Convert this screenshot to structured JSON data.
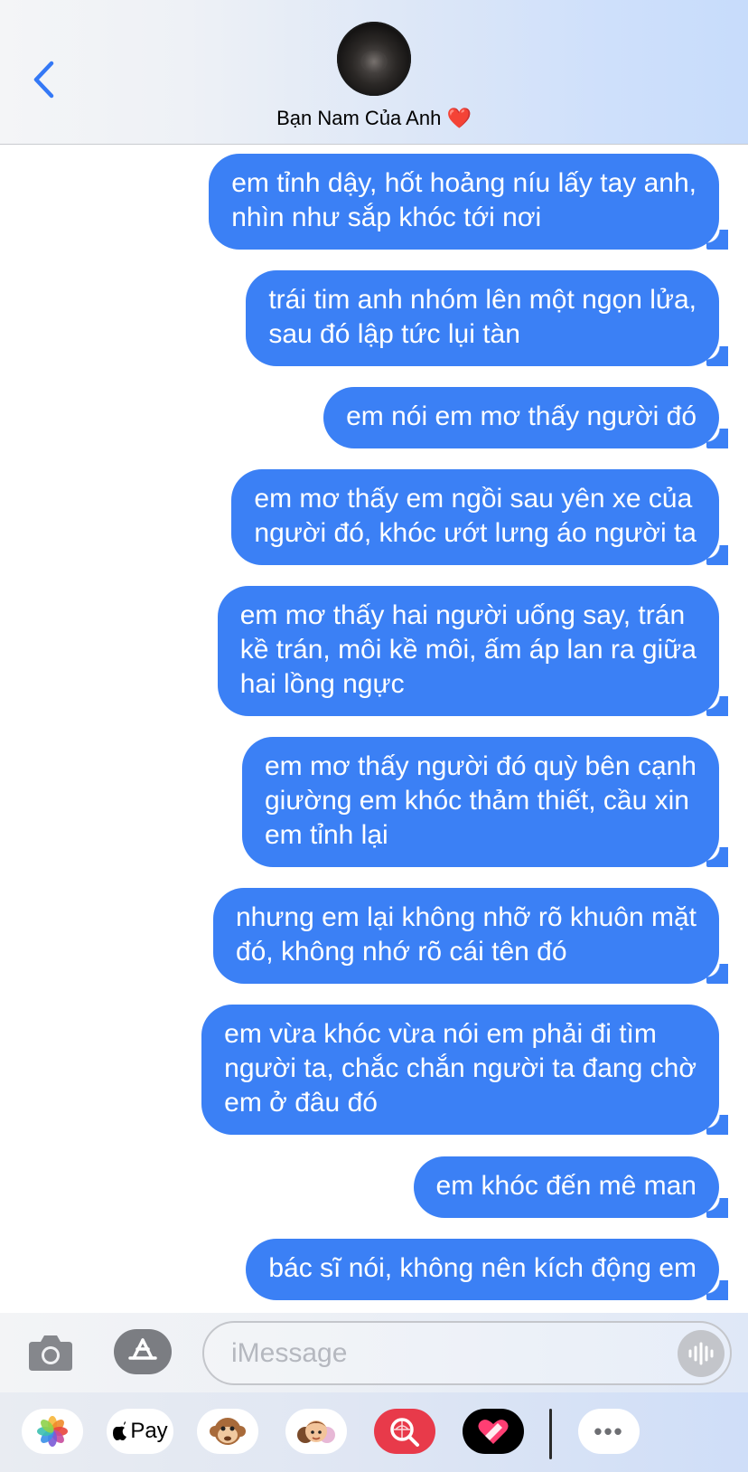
{
  "header": {
    "contact_name": "Bạn Nam Của Anh",
    "heart": "❤️"
  },
  "messages": [
    {
      "text": "em tỉnh dậy, hốt hoảng níu lấy tay anh,\nnhìn như sắp khóc tới nơi"
    },
    {
      "text": "trái tim anh nhóm lên một ngọn lửa,\nsau đó lập tức lụi tàn"
    },
    {
      "text": "em nói em mơ thấy người đó"
    },
    {
      "text": "em mơ thấy em ngồi sau yên xe của\nngười đó, khóc ướt lưng áo người ta"
    },
    {
      "text": "em mơ thấy hai người uống say, trán\nkề trán, môi kề môi, ấm áp lan ra giữa\nhai lồng ngực"
    },
    {
      "text": "em mơ thấy người đó quỳ bên cạnh\ngiường em khóc thảm thiết, cầu xin\nem tỉnh lại"
    },
    {
      "text": "nhưng em lại không nhỡ rõ khuôn mặt\nđó, không nhớ rõ cái tên đó"
    },
    {
      "text": "em vừa khóc vừa nói em phải đi tìm\nngười ta, chắc chắn người ta đang chờ\nem ở đâu đó"
    },
    {
      "text": "em khóc đến mê man"
    },
    {
      "text": "bác sĩ nói, không nên kích động em"
    }
  ],
  "input": {
    "placeholder": "iMessage"
  },
  "app_drawer": {
    "apple_pay_label": "Pay",
    "more_label": "•••"
  },
  "colors": {
    "bubble": "#3b80f5",
    "accent": "#3478f6"
  },
  "icons": [
    "back-chevron-icon",
    "camera-icon",
    "app-store-icon",
    "voice-waveform-icon",
    "photos-icon",
    "apple-pay-icon",
    "animoji-monkey-icon",
    "memoji-icon",
    "search-images-icon",
    "digital-touch-icon",
    "more-icon"
  ]
}
